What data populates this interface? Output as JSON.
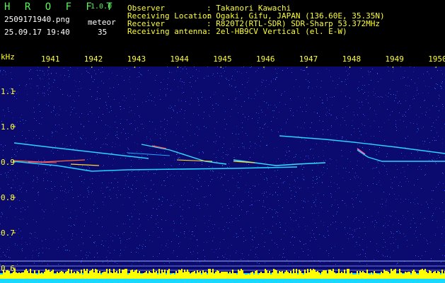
{
  "app": {
    "name": "H R O F F T",
    "version": "1.0.0",
    "filename": "2509171940.png",
    "datetime": "25.09.17 19:40",
    "meteor_label": "meteor",
    "meteor_count": "35"
  },
  "info": {
    "observer_label": "Observer",
    "observer_value": ": Takanori Kawachi",
    "location_label": "Receiving Location",
    "location_value": ": Ogaki, Gifu, JAPAN (136.60E, 35.35N)",
    "receiver_label": "Receiver",
    "receiver_value": ": R820T2(RTL-SDR) SDR-Sharp 53.372MHz",
    "antenna_label": "Receiving antenna",
    "antenna_value": ": 2el-HB9CV Vertical (el. E-W)"
  },
  "axis": {
    "unit": "kHz",
    "time_ticks": [
      "1941",
      "1942",
      "1943",
      "1944",
      "1945",
      "1946",
      "1947",
      "1948",
      "1949",
      "1950"
    ],
    "freq_ticks": [
      "1.1",
      "1.0",
      "0.9",
      "0.8",
      "0.7",
      "0.6"
    ]
  },
  "colors": {
    "background": "#0b0a6e",
    "tick_text": "#ffff33",
    "header_green": "#5cf25c",
    "level_yellow": "#ffff00",
    "level_cyan": "#19d8ff"
  }
}
